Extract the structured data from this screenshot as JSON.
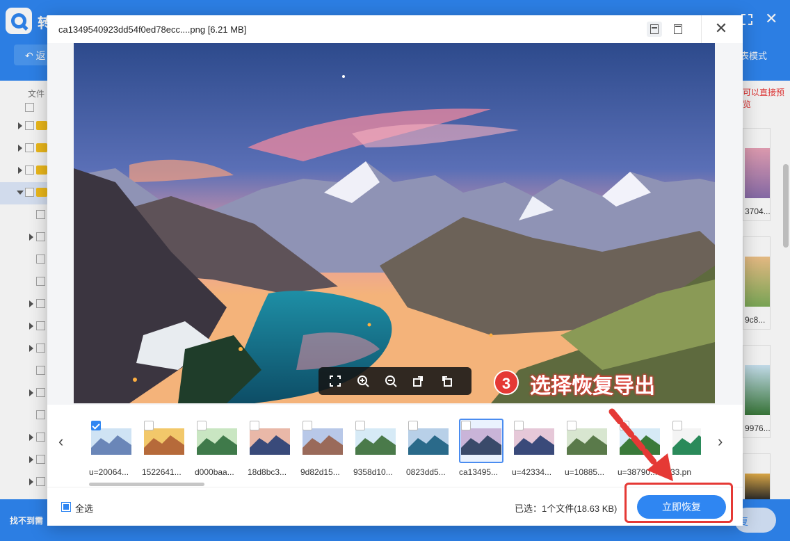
{
  "background_app": {
    "title": "转",
    "back_label": "返",
    "list_mode_label": "表模式",
    "column_header": "文件",
    "hint_text": "可以直接预览",
    "bottom_hint": "找不到需",
    "bottom_button": "复",
    "right_thumb_labels": [
      "3704...",
      "9c8...",
      "9976..."
    ]
  },
  "dialog": {
    "title": "ca1349540923dd54f0ed78ecc....png [6.21 MB]",
    "close_glyph": "✕",
    "prev_glyph": "‹",
    "next_glyph": "›"
  },
  "annotation": {
    "step_number": "3",
    "step_text": "选择恢复导出",
    "accent_color": "#e53935"
  },
  "thumbnails": [
    {
      "name": "u=20064...",
      "checked": true,
      "active": false
    },
    {
      "name": "1522641...",
      "checked": false,
      "active": false
    },
    {
      "name": "d000baa...",
      "checked": false,
      "active": false
    },
    {
      "name": "18d8bc3...",
      "checked": false,
      "active": false
    },
    {
      "name": "9d82d15...",
      "checked": false,
      "active": false
    },
    {
      "name": "9358d10...",
      "checked": false,
      "active": false
    },
    {
      "name": "0823dd5...",
      "checked": false,
      "active": false
    },
    {
      "name": "ca13495...",
      "checked": false,
      "active": true
    },
    {
      "name": "u=42334...",
      "checked": false,
      "active": false
    },
    {
      "name": "u=10885...",
      "checked": false,
      "active": false
    },
    {
      "name": "u=38790...",
      "checked": false,
      "active": false
    },
    {
      "name": "33.pn",
      "checked": false,
      "active": false
    }
  ],
  "footer": {
    "select_all_label": "全选",
    "selected_info": "已选：1个文件(18.63 KB)",
    "recover_button": "立即恢复"
  },
  "colors": {
    "brand_blue": "#2f86f2",
    "highlight_red": "#e53935"
  }
}
